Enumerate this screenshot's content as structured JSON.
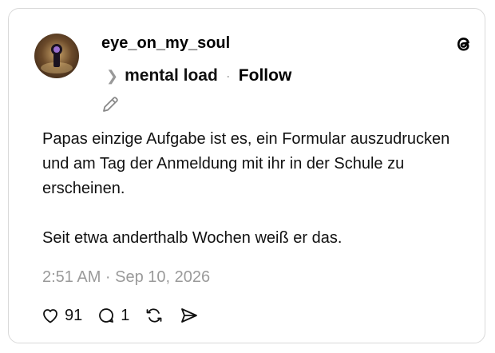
{
  "post": {
    "username": "eye_on_my_soul",
    "topic": "mental load",
    "separator": "·",
    "follow_label": "Follow",
    "paragraphs": [
      "Papas einzige Aufgabe ist es, ein Formular auszudrucken und am Tag der Anmeldung mit ihr in der Schule zu erscheinen.",
      "Seit etwa anderthalb Wochen weiß er das."
    ],
    "timestamp": "2:51 AM · Sep 10, 2026",
    "likes": "91",
    "replies": "1"
  },
  "icons": {
    "logo": "threads-logo-icon",
    "topic_chevron": "chevron-right-icon",
    "edit": "pencil-icon",
    "like": "heart-icon",
    "reply": "comment-icon",
    "repost": "repost-icon",
    "share": "send-icon"
  }
}
